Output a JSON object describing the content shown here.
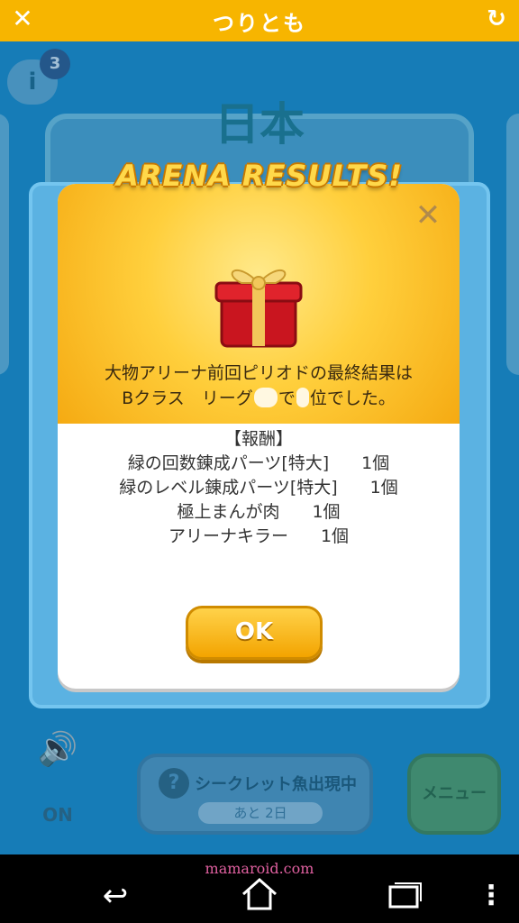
{
  "app": {
    "title": "つりとも",
    "close_icon": "close-icon",
    "reload_icon": "reload-icon"
  },
  "background": {
    "country": "日本",
    "info_badge_count": "3",
    "sound_label": "ON",
    "secret_title": "シークレット魚出現中",
    "secret_remaining": "あと 2日",
    "menu_label": "メニュー"
  },
  "modal": {
    "banner": "ARENA RESULTS!",
    "message_line1": "大物アリーナ前回ピリオドの最終結果は",
    "message_line2_a": "Bクラス　リーグ",
    "message_line2_b": "で",
    "message_line2_c": "位でした。",
    "rewards_header": "【報酬】",
    "rewards": [
      {
        "name": "緑の回数錬成パーツ[特大]",
        "qty": "1個"
      },
      {
        "name": "緑のレベル錬成パーツ[特大]",
        "qty": "1個"
      },
      {
        "name": "極上まんが肉",
        "qty": "1個"
      },
      {
        "name": "アリーナキラー",
        "qty": "1個"
      }
    ],
    "ok_label": "OK"
  },
  "navbar": {
    "watermark": "mamaroid.com"
  },
  "colors": {
    "accent": "#f7b500",
    "background": "#1a8fd0",
    "ok_button": "#f3a400"
  }
}
